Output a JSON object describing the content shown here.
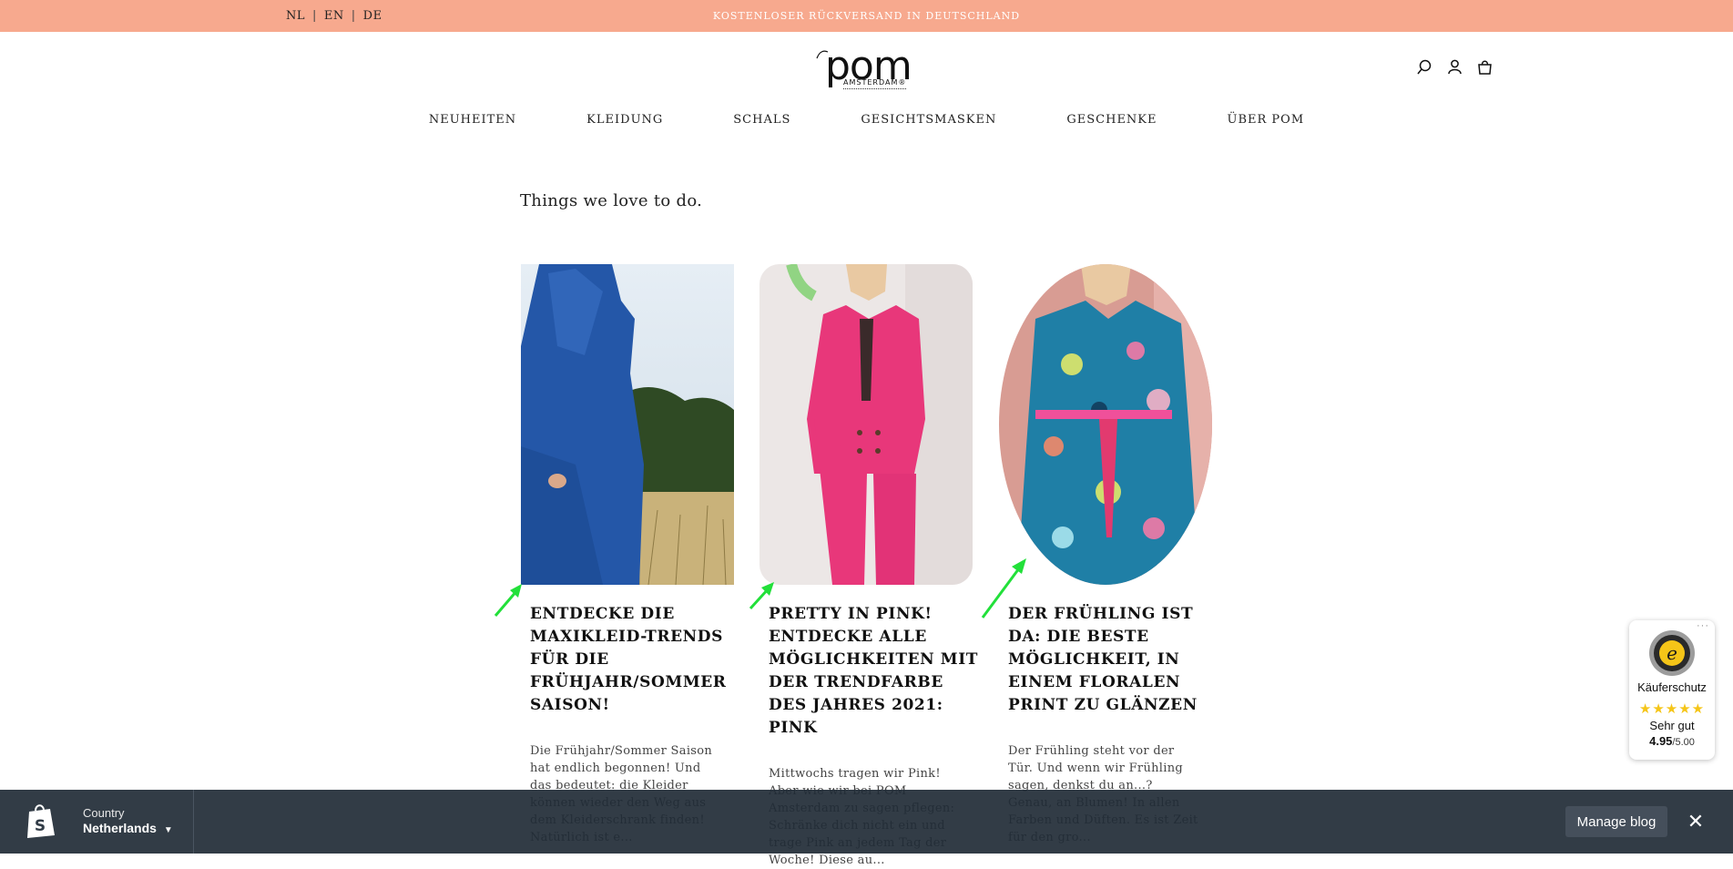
{
  "topbar": {
    "languages": [
      "NL",
      "EN",
      "DE"
    ],
    "announcement": "KOSTENLOSER RÜCKVERSAND IN DEUTSCHLAND"
  },
  "header": {
    "logo_main": "pom",
    "logo_sub": "AMSTERDAM®",
    "icons": [
      "search-icon",
      "account-icon",
      "cart-icon"
    ]
  },
  "nav": [
    "NEUHEITEN",
    "KLEIDUNG",
    "SCHALS",
    "GESICHTSMASKEN",
    "GESCHENKE",
    "ÜBER POM"
  ],
  "page": {
    "heading": "Things we love to do."
  },
  "articles": [
    {
      "title": "ENTDECKE DIE MAXIKLEID-TRENDS FÜR DIE FRÜHJAHR/SOMMER SAISON!",
      "excerpt": "Die Frühjahr/Sommer Saison hat endlich begonnen! Und das bedeutet: die Kleider können wieder den Weg aus dem Kleiderschrank finden! Natürlich ist e...",
      "image": "blue-maxi-dress-photo"
    },
    {
      "title": "PRETTY IN PINK! ENTDECKE ALLE MÖGLICHKEITEN MIT DER TRENDFARBE DES JAHRES 2021: PINK",
      "excerpt": "Mittwochs tragen wir Pink! Aber wie wir bei POM Amsterdam zu sagen pflegen: Schränke dich nicht ein und trage Pink an jedem Tag der Woche! Diese au...",
      "image": "pink-suit-photo"
    },
    {
      "title": "DER FRÜHLING IST DA: DIE BESTE MÖGLICHKEIT, IN EINEM FLORALEN PRINT ZU GLÄNZEN",
      "excerpt": "Der Frühling steht vor der Tür. Und wenn wir Frühling sagen, denkst du an...? Genau, an Blumen! In allen Farben und Düften. Es ist Zeit für den gro...",
      "image": "floral-dress-photo"
    }
  ],
  "trust_badge": {
    "dots": "···",
    "label": "Käuferschutz",
    "stars": "★★★★★",
    "rating_word": "Sehr gut",
    "score": "4.95",
    "score_max": "/5.00"
  },
  "admin_bar": {
    "country_label": "Country",
    "country_value": "Netherlands",
    "manage_button": "Manage blog",
    "close_glyph": "✕"
  },
  "colors": {
    "topbar": "#f7a98e",
    "admin_bar": "#212b36",
    "arrow": "#22e03a",
    "star": "#f5c518"
  }
}
